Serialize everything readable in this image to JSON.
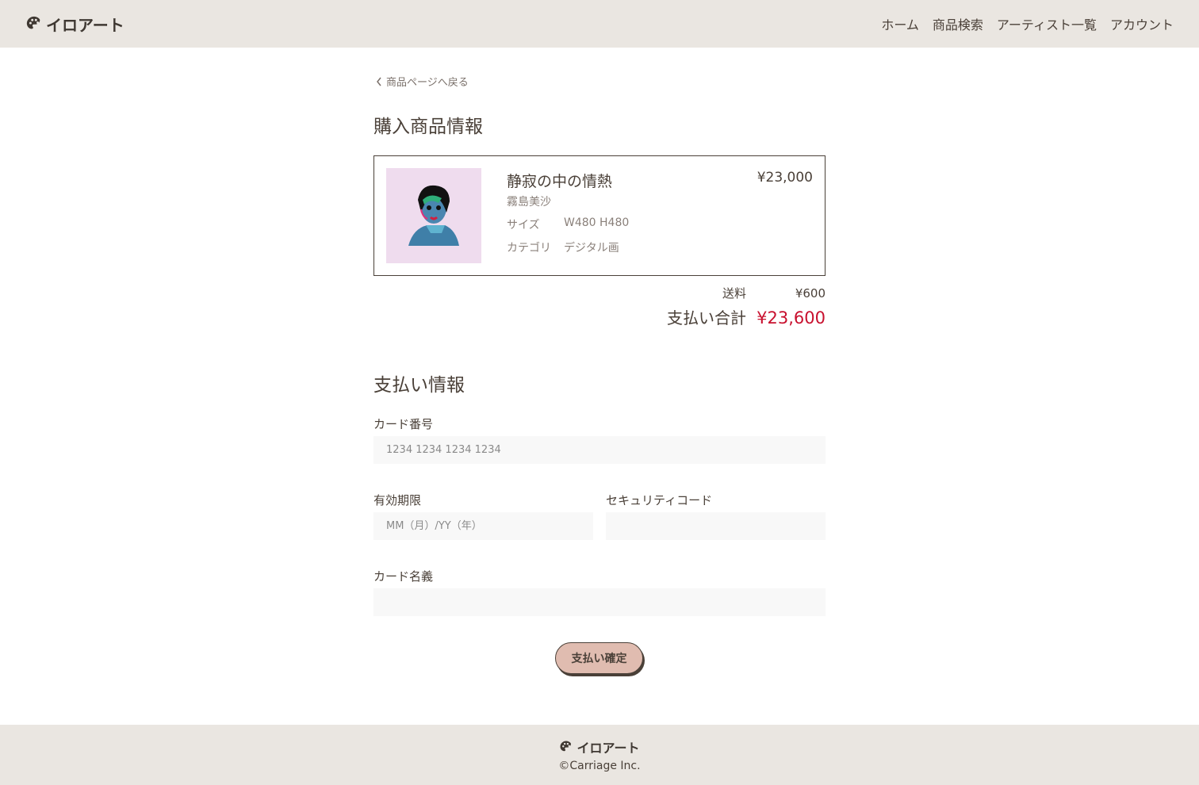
{
  "header": {
    "logo_text": "イロアート",
    "logo_icon": "palette-icon",
    "nav": [
      {
        "label": "ホーム"
      },
      {
        "label": "商品検索"
      },
      {
        "label": "アーティスト一覧"
      },
      {
        "label": "アカウント"
      }
    ]
  },
  "back_link": {
    "label": "商品ページへ戻る",
    "icon": "chevron-left-icon"
  },
  "purchase": {
    "title": "購入商品情報",
    "product": {
      "title": "静寂の中の情熱",
      "artist": "霧島美沙",
      "size_label": "サイズ",
      "size_value": "W480 H480",
      "category_label": "カテゴリ",
      "category_value": "デジタル画",
      "price": "¥23,000"
    },
    "shipping_label": "送料",
    "shipping_value": "¥600",
    "total_label": "支払い合計",
    "total_value": "¥23,600"
  },
  "payment": {
    "title": "支払い情報",
    "card_number_label": "カード番号",
    "card_number_placeholder": "1234 1234 1234 1234",
    "expiry_label": "有効期限",
    "expiry_placeholder": "MM（月）/YY（年）",
    "cvc_label": "セキュリティコード",
    "cvc_placeholder": "",
    "name_label": "カード名義",
    "name_placeholder": "",
    "confirm_label": "支払い確定"
  },
  "footer": {
    "logo_text": "イロアート",
    "copyright": "©Carriage Inc."
  },
  "colors": {
    "header_bg": "#eae6e1",
    "text": "#4a4038",
    "total_accent": "#c8102e",
    "button_bg": "#e0bcb0",
    "thumb_bg": "#efdcee"
  }
}
